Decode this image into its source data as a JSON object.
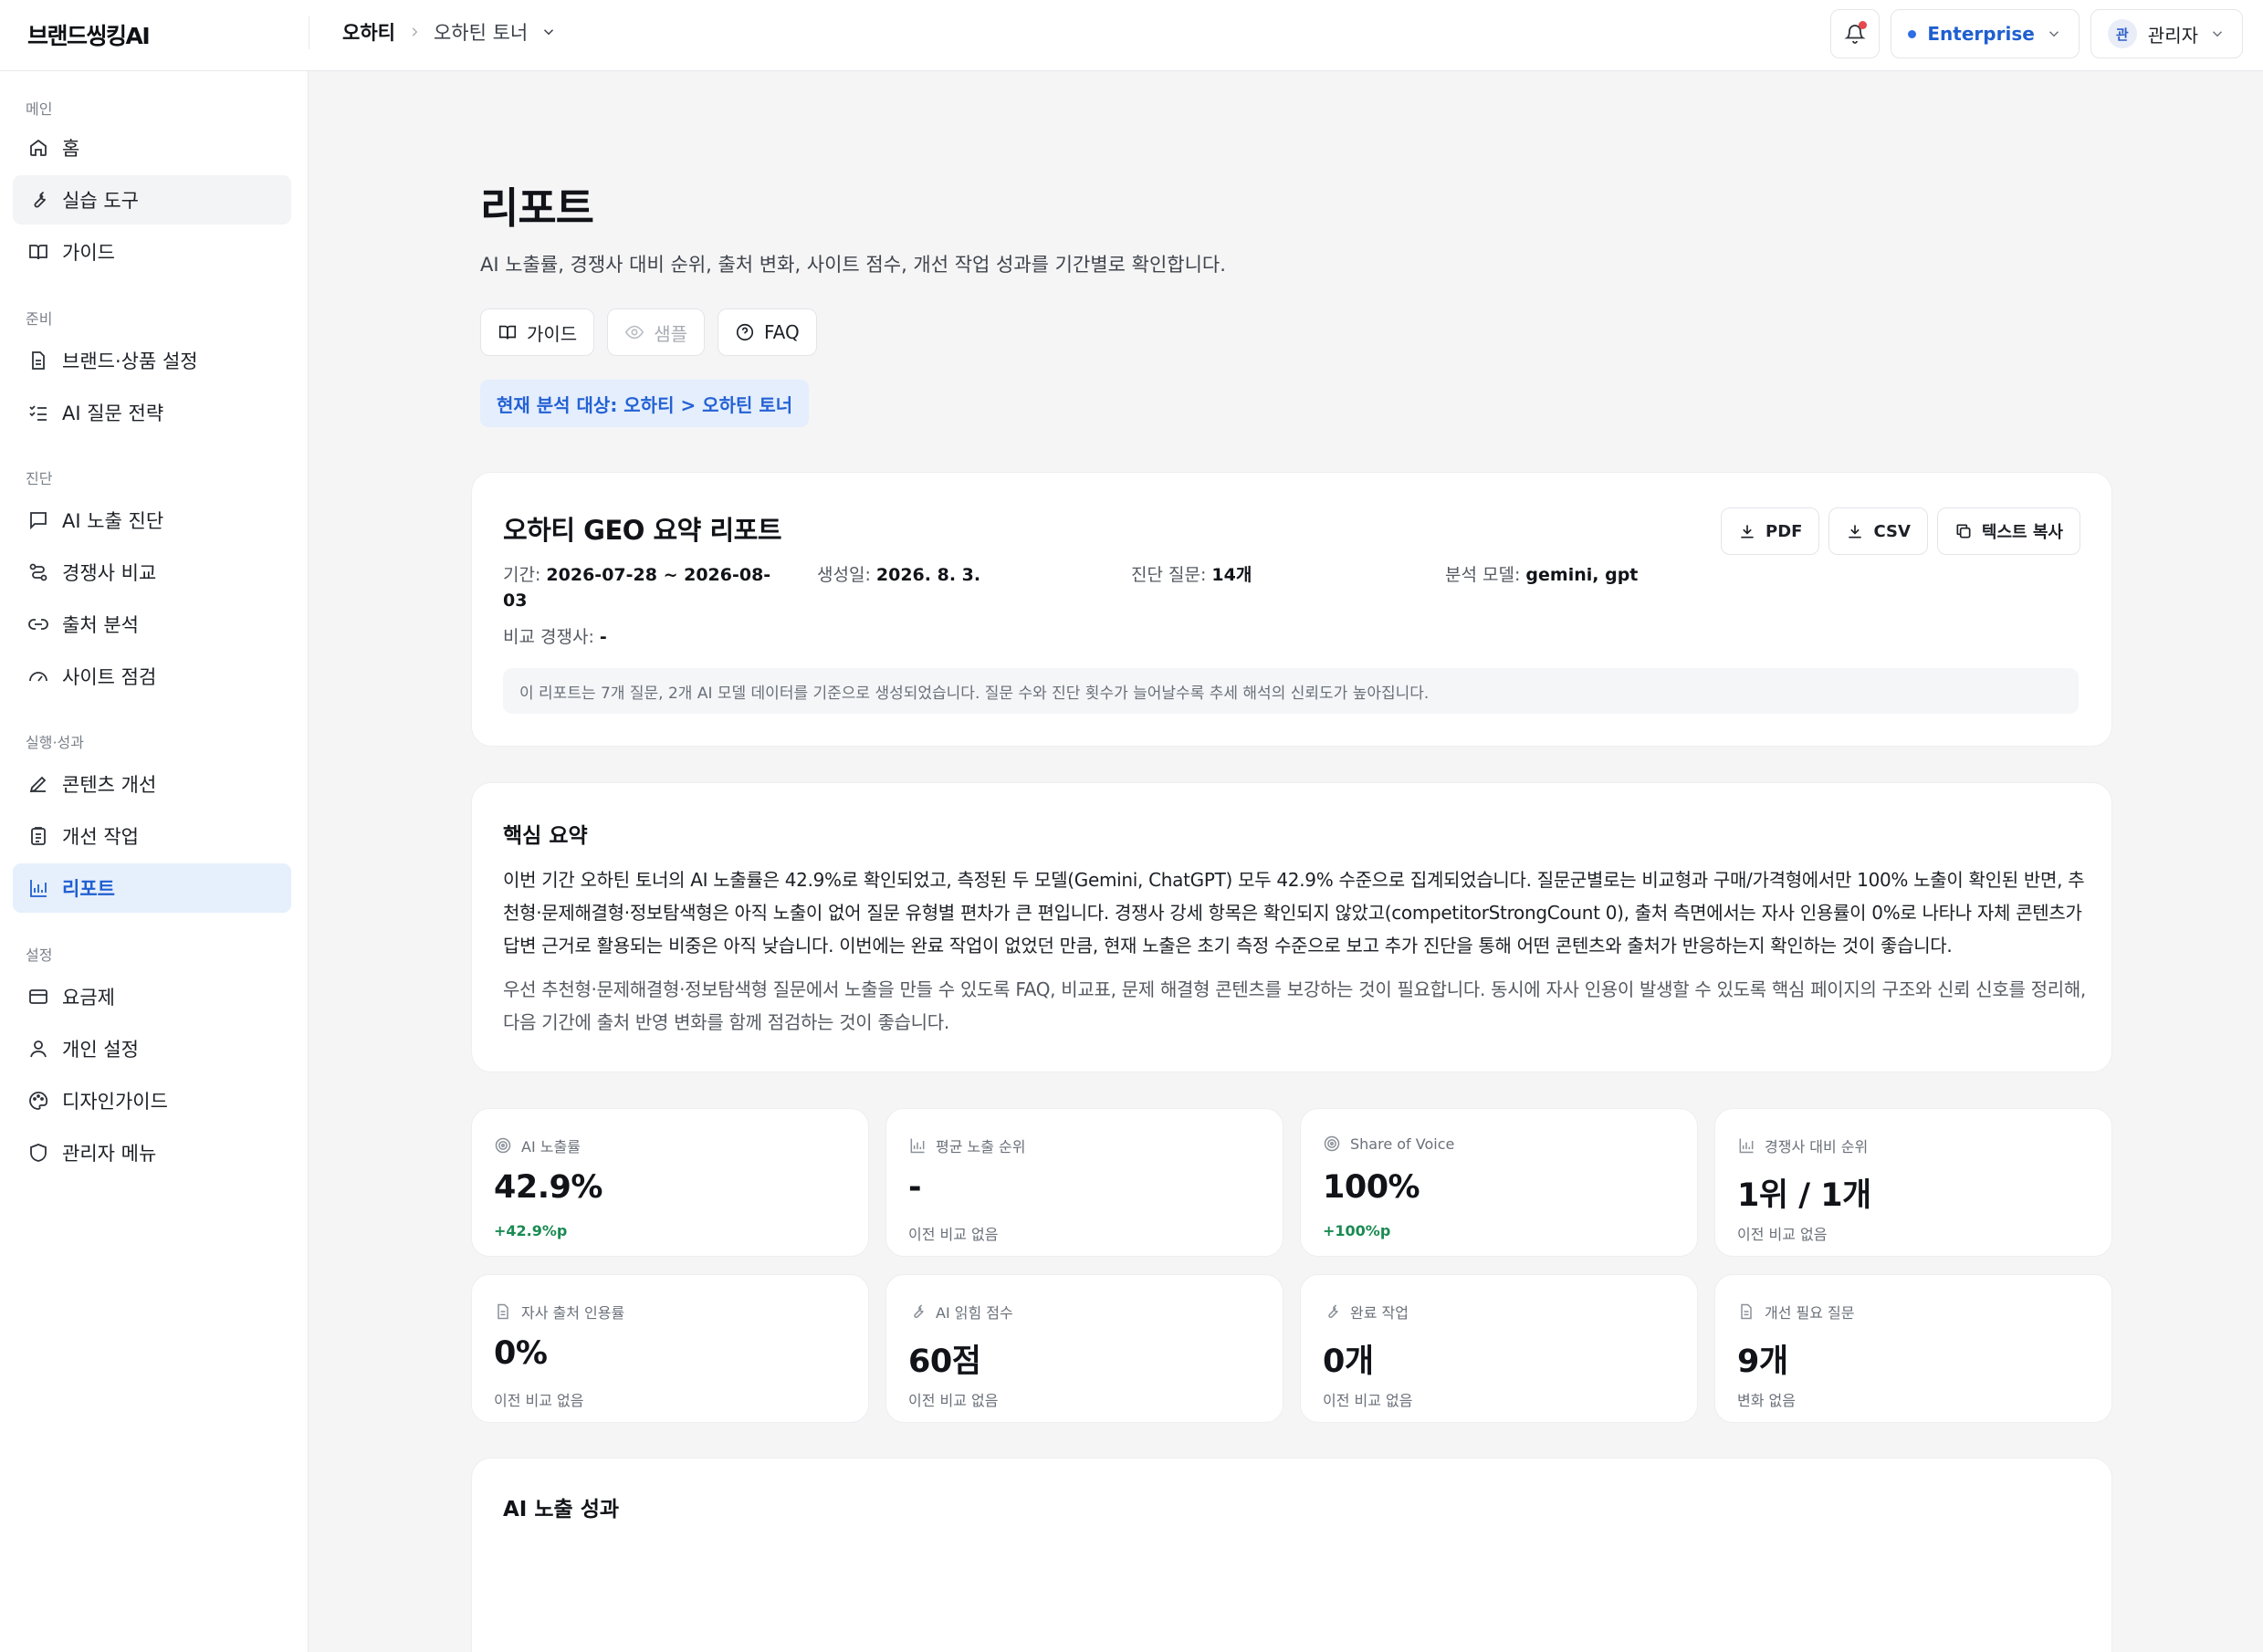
{
  "app": {
    "logo": "브랜드씽킹AI"
  },
  "header": {
    "breadcrumb_root": "오하티",
    "breadcrumb_current": "오하틴 토너",
    "plan_label": "Enterprise",
    "avatar_initial": "관",
    "user_label": "관리자"
  },
  "sidebar": {
    "sections": [
      "메인",
      "준비",
      "진단",
      "실행·성과",
      "설정"
    ],
    "items": [
      {
        "label": "홈",
        "icon": "home-icon"
      },
      {
        "label": "실습 도구",
        "icon": "wrench-icon"
      },
      {
        "label": "가이드",
        "icon": "book-icon"
      },
      {
        "label": "브랜드·상품 설정",
        "icon": "document-icon"
      },
      {
        "label": "AI 질문 전략",
        "icon": "checklist-icon"
      },
      {
        "label": "AI 노출 진단",
        "icon": "message-icon"
      },
      {
        "label": "경쟁사 비교",
        "icon": "route-icon"
      },
      {
        "label": "출처 분석",
        "icon": "link-icon"
      },
      {
        "label": "사이트 점검",
        "icon": "gauge-icon"
      },
      {
        "label": "콘텐츠 개선",
        "icon": "pen-icon"
      },
      {
        "label": "개선 작업",
        "icon": "clipboard-icon"
      },
      {
        "label": "리포트",
        "icon": "bar-chart-icon"
      },
      {
        "label": "요금제",
        "icon": "card-icon"
      },
      {
        "label": "개인 설정",
        "icon": "user-icon"
      },
      {
        "label": "디자인가이드",
        "icon": "palette-icon"
      },
      {
        "label": "관리자 메뉴",
        "icon": "shield-icon"
      }
    ]
  },
  "page": {
    "title": "리포트",
    "subtitle": "AI 노출률, 경쟁사 대비 순위, 출처 변화, 사이트 점수, 개선 작업 성과를 기간별로 확인합니다.",
    "buttons": {
      "guide": "가이드",
      "sample": "샘플",
      "faq": "FAQ"
    },
    "target_chip": "현재 분석 대상: 오하티 > 오하틴 토너"
  },
  "report": {
    "title": "오하티 GEO 요약 리포트",
    "export": {
      "pdf": "PDF",
      "csv": "CSV",
      "copy": "텍스트 복사"
    },
    "period_label": "기간:",
    "period_value_1": "2026-07-28 ~ 2026-08-",
    "period_value_2": "03",
    "created_label": "생성일:",
    "created_value": "2026. 8. 3.",
    "questions_label": "진단 질문:",
    "questions_value": "14개",
    "models_label": "분석 모델:",
    "models_value": "gemini, gpt",
    "competitors_label": "비교 경쟁사:",
    "competitors_value": "-",
    "notice": "이 리포트는 7개 질문, 2개 AI 모델 데이터를 기준으로 생성되었습니다. 질문 수와 진단 횟수가 늘어날수록 추세 해석의 신뢰도가 높아집니다."
  },
  "summary": {
    "title": "핵심 요약",
    "paragraph_1": "이번 기간 오하틴 토너의 AI 노출률은 42.9%로 확인되었고, 측정된 두 모델(Gemini, ChatGPT) 모두 42.9% 수준으로 집계되었습니다. 질문군별로는 비교형과 구매/가격형에서만 100% 노출이 확인된 반면, 추천형·문제해결형·정보탐색형은 아직 노출이 없어 질문 유형별 편차가 큰 편입니다. 경쟁사 강세 항목은 확인되지 않았고(competitorStrongCount 0), 출처 측면에서는 자사 인용률이 0%로 나타나 자체 콘텐츠가 답변 근거로 활용되는 비중은 아직 낮습니다. 이번에는 완료 작업이 없었던 만큼, 현재 노출은 초기 측정 수준으로 보고 추가 진단을 통해 어떤 콘텐츠와 출처가 반응하는지 확인하는 것이 좋습니다.",
    "paragraph_2": "우선 추천형·문제해결형·정보탐색형 질문에서 노출을 만들 수 있도록 FAQ, 비교표, 문제 해결형 콘텐츠를 보강하는 것이 필요합니다. 동시에 자사 인용이 발생할 수 있도록 핵심 페이지의 구조와 신뢰 신호를 정리해, 다음 기간에 출처 반영 변화를 함께 점검하는 것이 좋습니다."
  },
  "metrics": [
    {
      "label": "AI 노출률",
      "value": "42.9%",
      "delta": "+42.9%p",
      "trend": "up",
      "icon": "target-icon"
    },
    {
      "label": "평균 노출 순위",
      "value": "-",
      "delta": "이전 비교 없음",
      "trend": "none",
      "icon": "bar-chart-icon"
    },
    {
      "label": "Share of Voice",
      "value": "100%",
      "delta": "+100%p",
      "trend": "up",
      "icon": "target-icon"
    },
    {
      "label": "경쟁사 대비 순위",
      "value": "1위 / 1개",
      "delta": "이전 비교 없음",
      "trend": "none",
      "icon": "bar-chart-icon"
    },
    {
      "label": "자사 출처 인용률",
      "value": "0%",
      "delta": "이전 비교 없음",
      "trend": "none",
      "icon": "document-icon"
    },
    {
      "label": "AI 읽힘 점수",
      "value": "60점",
      "delta": "이전 비교 없음",
      "trend": "none",
      "icon": "wrench-icon"
    },
    {
      "label": "완료 작업",
      "value": "0개",
      "delta": "이전 비교 없음",
      "trend": "none",
      "icon": "wrench-icon"
    },
    {
      "label": "개선 필요 질문",
      "value": "9개",
      "delta": "변화 없음",
      "trend": "none",
      "icon": "document-icon"
    }
  ],
  "exposure": {
    "title": "AI 노출 성과"
  },
  "colors": {
    "accent": "#1f5fd0",
    "accent_bg": "#e6effc",
    "positive": "#1a8a52",
    "alert_dot": "#e5484d"
  }
}
